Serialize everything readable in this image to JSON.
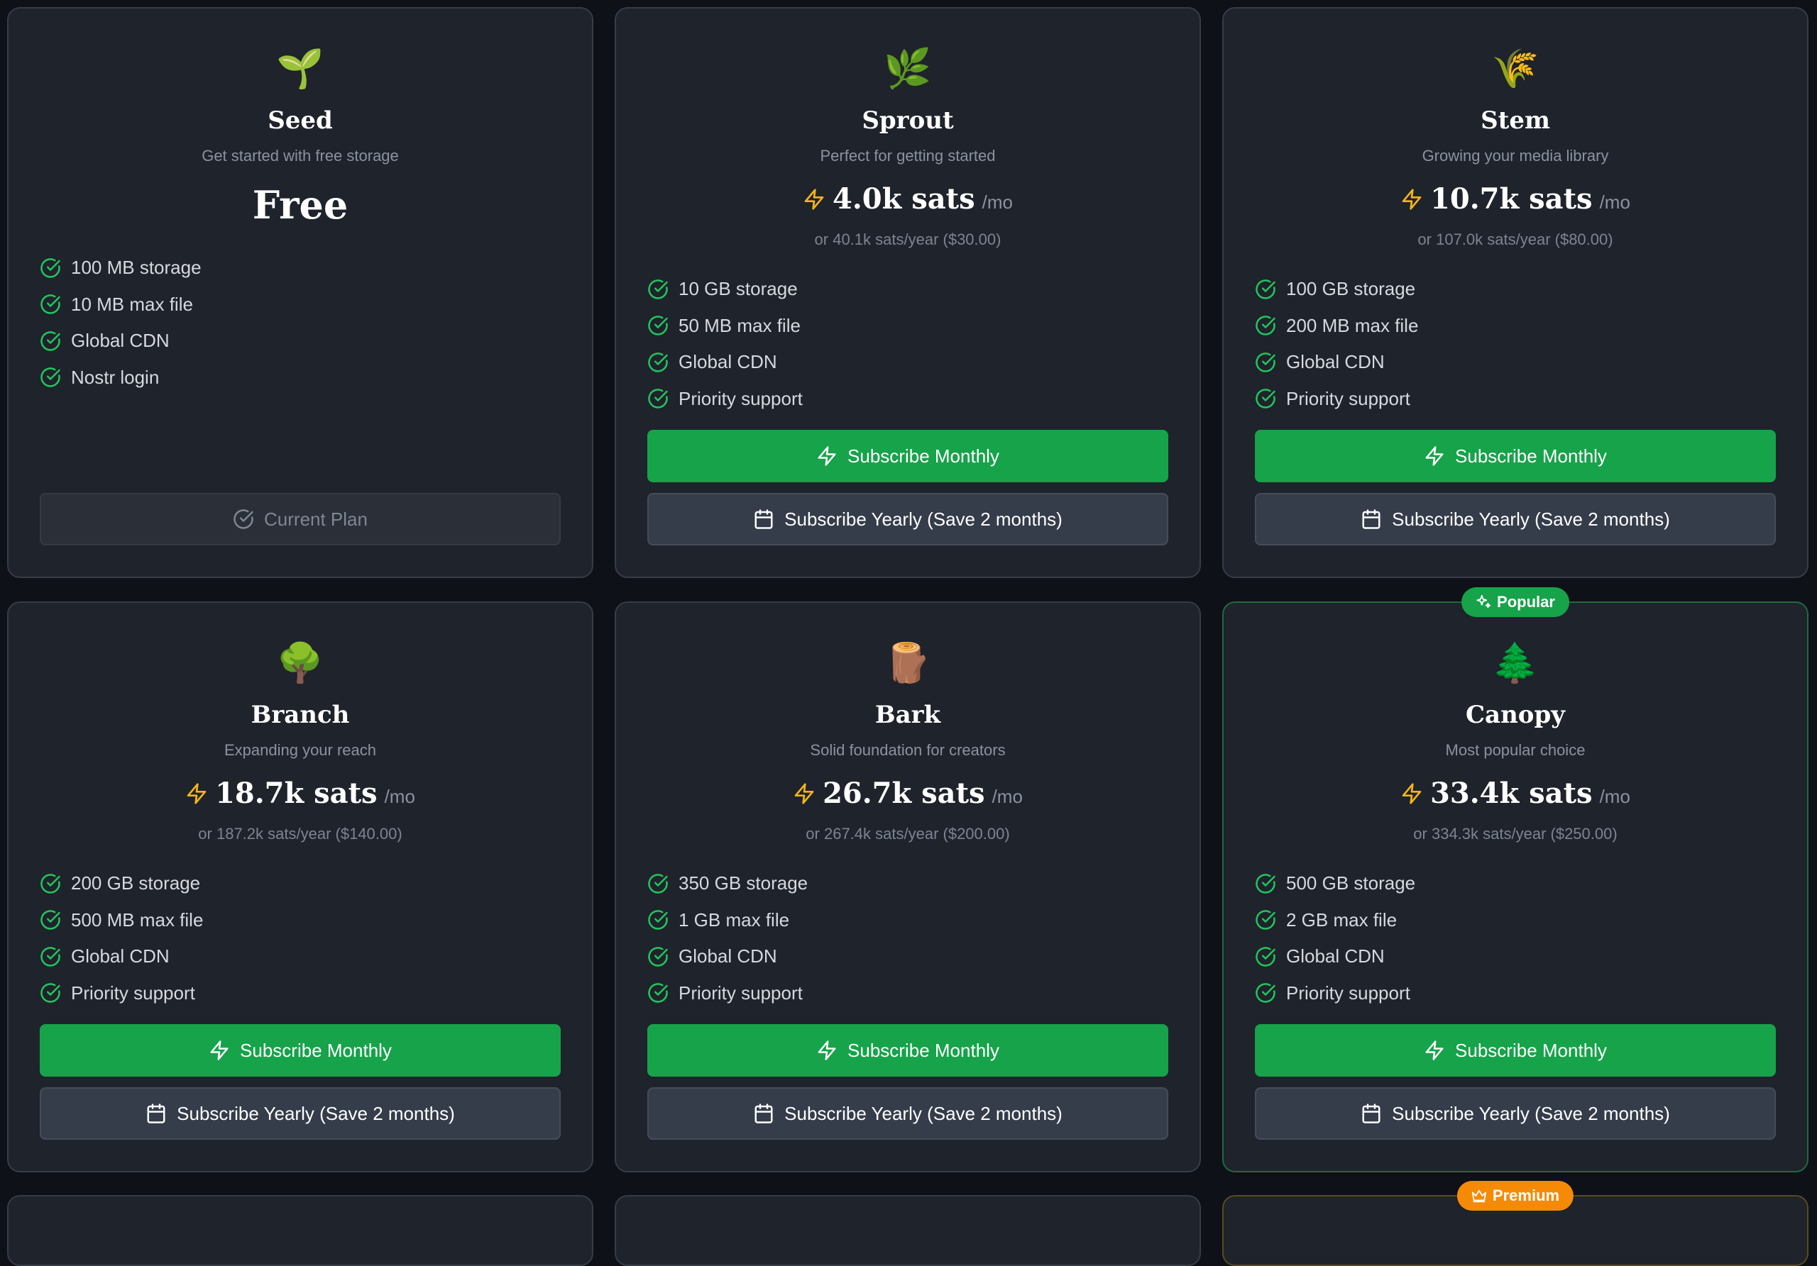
{
  "colors": {
    "background": "#0e1117",
    "card": "#1f232b",
    "accent_green": "#16a34a",
    "bolt_yellow": "#f5b51b",
    "check_green": "#22c55e",
    "premium_orange": "#f58a07"
  },
  "plans": [
    {
      "emoji": "🌱",
      "name": "Seed",
      "tagline": "Get started with free storage",
      "price_label": "Free",
      "features": [
        "100 MB storage",
        "10 MB max file",
        "Global CDN",
        "Nostr login"
      ],
      "current_label": "Current Plan"
    },
    {
      "emoji": "🌿",
      "name": "Sprout",
      "tagline": "Perfect for getting started",
      "price": "4.0k sats",
      "per": "/mo",
      "yearly": "or 40.1k sats/year ($30.00)",
      "features": [
        "10 GB storage",
        "50 MB max file",
        "Global CDN",
        "Priority support"
      ],
      "monthly_label": "Subscribe Monthly",
      "yearly_label": "Subscribe Yearly (Save 2 months)"
    },
    {
      "emoji": "🌾",
      "name": "Stem",
      "tagline": "Growing your media library",
      "price": "10.7k sats",
      "per": "/mo",
      "yearly": "or 107.0k sats/year ($80.00)",
      "features": [
        "100 GB storage",
        "200 MB max file",
        "Global CDN",
        "Priority support"
      ],
      "monthly_label": "Subscribe Monthly",
      "yearly_label": "Subscribe Yearly (Save 2 months)"
    },
    {
      "emoji": "🌳",
      "name": "Branch",
      "tagline": "Expanding your reach",
      "price": "18.7k sats",
      "per": "/mo",
      "yearly": "or 187.2k sats/year ($140.00)",
      "features": [
        "200 GB storage",
        "500 MB max file",
        "Global CDN",
        "Priority support"
      ],
      "monthly_label": "Subscribe Monthly",
      "yearly_label": "Subscribe Yearly (Save 2 months)"
    },
    {
      "emoji": "🪵",
      "name": "Bark",
      "tagline": "Solid foundation for creators",
      "price": "26.7k sats",
      "per": "/mo",
      "yearly": "or 267.4k sats/year ($200.00)",
      "features": [
        "350 GB storage",
        "1 GB max file",
        "Global CDN",
        "Priority support"
      ],
      "monthly_label": "Subscribe Monthly",
      "yearly_label": "Subscribe Yearly (Save 2 months)"
    },
    {
      "badge": "Popular",
      "emoji": "🌲",
      "name": "Canopy",
      "tagline": "Most popular choice",
      "price": "33.4k sats",
      "per": "/mo",
      "yearly": "or 334.3k sats/year ($250.00)",
      "features": [
        "500 GB storage",
        "2 GB max file",
        "Global CDN",
        "Priority support"
      ],
      "monthly_label": "Subscribe Monthly",
      "yearly_label": "Subscribe Yearly (Save 2 months)"
    },
    {
      "partial": true
    },
    {
      "partial": true
    },
    {
      "partial": true,
      "badge": "Premium"
    }
  ]
}
